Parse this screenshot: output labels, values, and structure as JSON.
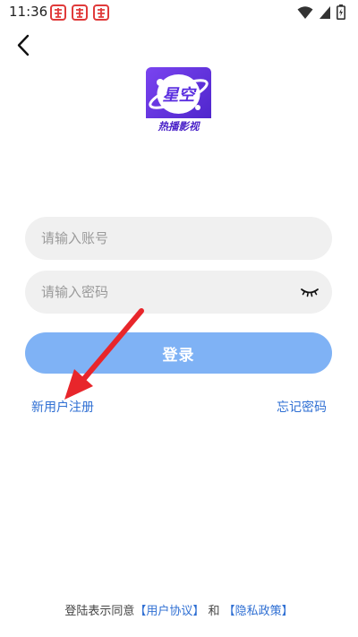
{
  "status_bar": {
    "time": "11:36",
    "notification_icons": [
      "app-notification-icon",
      "app-notification-icon",
      "app-notification-icon"
    ],
    "system_icons": [
      "wifi-icon",
      "signal-icon",
      "battery-icon"
    ]
  },
  "logo": {
    "text_top": "星空",
    "text_bottom": "热播影视",
    "colors": {
      "primary": "#5b2fe0",
      "secondary": "#7a44f0"
    }
  },
  "login_form": {
    "account_placeholder": "请输入账号",
    "password_placeholder": "请输入密码",
    "login_label": "登录"
  },
  "links": {
    "register": "新用户注册",
    "forgot_password": "忘记密码"
  },
  "agreement": {
    "prefix": "登陆表示同意",
    "user_agreement": "【用户协议】",
    "conjunction": "和",
    "privacy_policy": "【隐私政策】"
  },
  "colors": {
    "accent": "#7fb2f5",
    "link": "#2f6fd3",
    "annotation_arrow": "#e8262b"
  }
}
